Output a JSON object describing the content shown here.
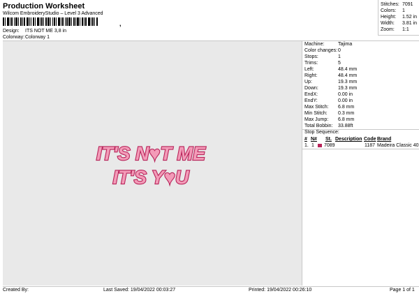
{
  "header": {
    "title": "Production Worksheet",
    "subtitle": "Wilcom EmbroideryStudio – Level 3 Advanced",
    "barcode_tail": ","
  },
  "info": {
    "design_label": "Design:",
    "design_value": "ITS NOT ME 3,8 in",
    "colorway_label": "Colorway:",
    "colorway_value": "Colorway 1"
  },
  "stats": [
    {
      "label": "Stitches:",
      "value": "7091"
    },
    {
      "label": "Colors:",
      "value": "1"
    },
    {
      "label": "Height:",
      "value": "1.52 in"
    },
    {
      "label": "Width:",
      "value": "3.81 in"
    },
    {
      "label": "Zoom:",
      "value": "1:1"
    }
  ],
  "design": {
    "line1": "IT'S N♥T ME",
    "line2": "IT'S Y♥U",
    "thread_color": "#b8245a",
    "fill_color": "#f39bb8"
  },
  "properties": [
    {
      "label": "Machine:",
      "value": "Tajima"
    },
    {
      "label": "Color changes:",
      "value": "0"
    },
    {
      "label": "Stops:",
      "value": "1"
    },
    {
      "label": "Trims:",
      "value": "5"
    },
    {
      "label": "Left:",
      "value": "48.4 mm"
    },
    {
      "label": "Right:",
      "value": "48.4 mm"
    },
    {
      "label": "Up:",
      "value": "19.3 mm"
    },
    {
      "label": "Down:",
      "value": "19.3 mm"
    },
    {
      "label": "EndX:",
      "value": "0.00 in"
    },
    {
      "label": "EndY:",
      "value": "0.00 in"
    },
    {
      "label": "Max Stitch:",
      "value": "6.8 mm"
    },
    {
      "label": "Min Stitch:",
      "value": "0.3 mm"
    },
    {
      "label": "Max Jump:",
      "value": "6.8 mm"
    },
    {
      "label": "Total Bobbin:",
      "value": "33.88ft"
    }
  ],
  "stop_sequence": {
    "title": "Stop Sequence:",
    "headers": [
      "#",
      "N#",
      "St.",
      "Description",
      "Code",
      "Brand"
    ],
    "rows": [
      {
        "num": "1.",
        "n": "1",
        "swatch": "#b8245a",
        "description": "7089",
        "code": "1187",
        "brand": "Madeira Classic 40"
      }
    ]
  },
  "footer": {
    "created_by": "Created By:",
    "last_saved": "Last Saved: 19/04/2022 00:03:27",
    "printed": "Printed: 19/04/2022 00:26:10",
    "page": "Page 1 of 1"
  }
}
